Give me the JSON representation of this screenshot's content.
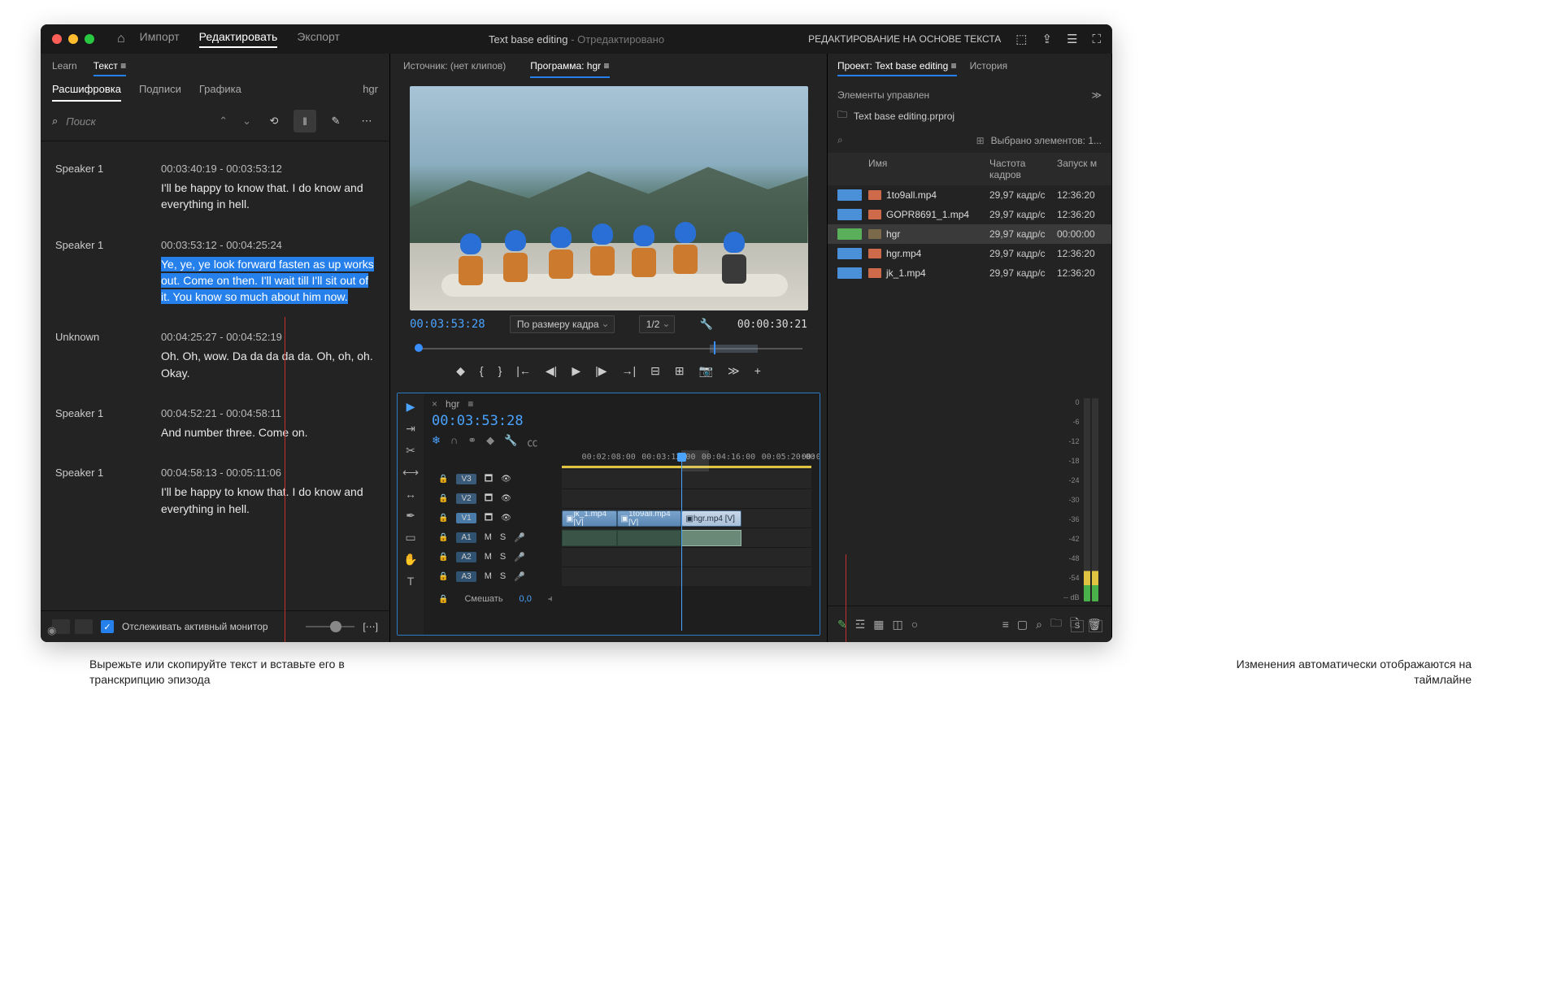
{
  "titlebar": {
    "tabs": {
      "import": "Импорт",
      "edit": "Редактировать",
      "export": "Экспорт"
    },
    "title": "Text base editing",
    "saved": "Отредактировано",
    "workspace": "РЕДАКТИРОВАНИЕ НА ОСНОВЕ ТЕКСТА"
  },
  "left": {
    "topTabs": {
      "learn": "Learn",
      "text": "Текст"
    },
    "subTabs": {
      "transcript": "Расшифровка",
      "captions": "Подписи",
      "graphics": "Графика",
      "clip": "hgr"
    },
    "search": "Поиск",
    "segments": [
      {
        "speaker": "Speaker 1",
        "tc": "00:03:40:19 - 00:03:53:12",
        "text": "I'll be happy to know that. I do know and everything in hell."
      },
      {
        "speaker": "Speaker 1",
        "tc": "00:03:53:12 - 00:04:25:24",
        "text": "Ye, ye, ye look forward fasten as up works out. Come on then. I'll wait till I'll sit out of it. You know so much about him now.",
        "selected": true
      },
      {
        "speaker": "Unknown",
        "tc": "00:04:25:27 - 00:04:52:19",
        "text": "Oh. Oh, wow. Da da da da da. Oh, oh, oh. Okay."
      },
      {
        "speaker": "Speaker 1",
        "tc": "00:04:52:21 - 00:04:58:11",
        "text": "And number three. Come on."
      },
      {
        "speaker": "Speaker 1",
        "tc": "00:04:58:13 - 00:05:11:06",
        "text": "I'll be happy to know that. I do know and everything in hell."
      }
    ],
    "follow": "Отслеживать активный монитор"
  },
  "center": {
    "tabs": {
      "source": "Источник: (нет клипов)",
      "program": "Программа: hgr"
    },
    "tc": "00:03:53:28",
    "fit": "По размеру кадра",
    "res": "1/2",
    "dur": "00:00:30:21",
    "timeline": {
      "seq": "hgr",
      "tc": "00:03:53:28",
      "ruler": [
        "00:02:08:00",
        "00:03:12:00",
        "00:04:16:00",
        "00:05:20:00",
        "00:0"
      ],
      "tracks": {
        "v3": "V3",
        "v2": "V2",
        "v1": "V1",
        "a1": "A1",
        "a2": "A2",
        "a3": "A3"
      },
      "letters": {
        "m": "M",
        "s": "S"
      },
      "clips": {
        "c1": "jk_1.mp4 [V]",
        "c2": "1to9all.mp4 [V]",
        "c3": "hgr.mp4 [V]"
      },
      "mix": "Смешать",
      "mixVal": "0,0"
    }
  },
  "right": {
    "tabs": {
      "project": "Проект: Text base editing",
      "history": "История",
      "controls": "Элементы управлен",
      "more": "≫"
    },
    "file": "Text base editing.prproj",
    "selected": "Выбрано элементов: 1...",
    "cols": {
      "name": "Имя",
      "fps": "Частота кадров",
      "start": "Запуск м"
    },
    "rows": [
      {
        "name": "1to9all.mp4",
        "fps": "29,97 кадр/с",
        "start": "12:36:20",
        "type": "clip"
      },
      {
        "name": "GOPR8691_1.mp4",
        "fps": "29,97 кадр/с",
        "start": "12:36:20",
        "type": "clip"
      },
      {
        "name": "hgr",
        "fps": "29,97 кадр/с",
        "start": "00:00:00",
        "type": "seq",
        "sel": true
      },
      {
        "name": "hgr.mp4",
        "fps": "29,97 кадр/с",
        "start": "12:36:20",
        "type": "clip"
      },
      {
        "name": "jk_1.mp4",
        "fps": "29,97 кадр/с",
        "start": "12:36:20",
        "type": "clip"
      }
    ],
    "meterScale": [
      "0",
      "-6",
      "-12",
      "-18",
      "-24",
      "-30",
      "-36",
      "-42",
      "-48",
      "-54",
      "--"
    ],
    "meterUnit": "dB",
    "meterBtns": {
      "s1": "S",
      "s2": "S"
    }
  },
  "callouts": {
    "left": "Вырежьте или скопируйте текст и вставьте его в транскрипцию эпизода",
    "right": "Изменения автоматически отображаются на таймлайне"
  }
}
